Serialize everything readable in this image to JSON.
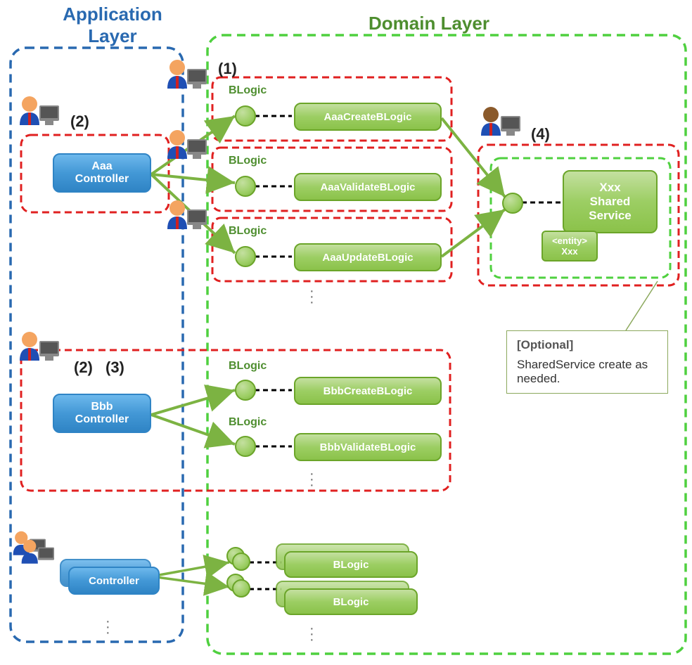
{
  "layers": {
    "application": "Application\nLayer",
    "domain": "Domain Layer"
  },
  "controllers": {
    "aaa": "Aaa\nController",
    "bbb": "Bbb\nController",
    "generic": "Controller"
  },
  "blogic_labels": {
    "l1": "BLogic",
    "l2": "BLogic",
    "l3": "BLogic",
    "l4": "BLogic",
    "l5": "BLogic"
  },
  "blogics": {
    "aaa_create": "AaaCreateBLogic",
    "aaa_validate": "AaaValidateBLogic",
    "aaa_update": "AaaUpdateBLogic",
    "bbb_create": "BbbCreateBLogic",
    "bbb_validate": "BbbValidateBLogic",
    "generic": "BLogic"
  },
  "shared": {
    "service": "Xxx\nShared\nService",
    "entity": "<entity>\nXxx"
  },
  "steps": {
    "s1": "(1)",
    "s2a": "(2)",
    "s2b": "(2)",
    "s3": "(3)",
    "s4": "(4)"
  },
  "note": {
    "title": "[Optional]",
    "body": "SharedService create as needed."
  },
  "colors": {
    "app_border": "#2969b0",
    "domain_border": "#4fd03f",
    "task_border": "#e02020"
  }
}
